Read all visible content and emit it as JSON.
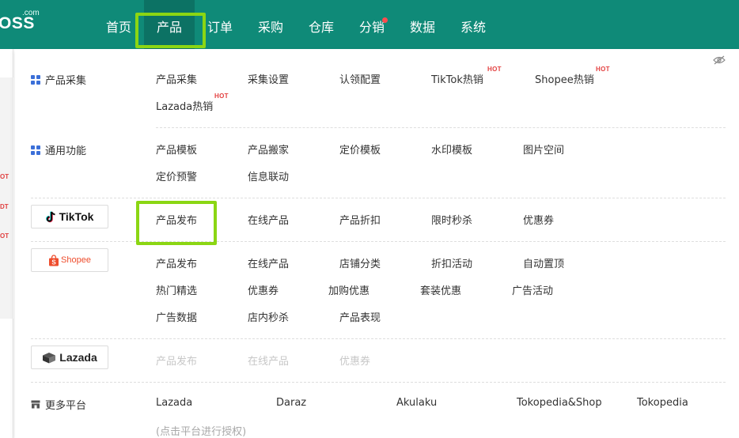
{
  "header": {
    "logo_suffix": ".com",
    "logo_text": "OSS",
    "nav": [
      {
        "label": "首页",
        "active": false,
        "dot": false
      },
      {
        "label": "产品",
        "active": true,
        "dot": false
      },
      {
        "label": "订单",
        "active": false,
        "dot": false
      },
      {
        "label": "采购",
        "active": false,
        "dot": false
      },
      {
        "label": "仓库",
        "active": false,
        "dot": false
      },
      {
        "label": "分销",
        "active": false,
        "dot": true
      },
      {
        "label": "数据",
        "active": false,
        "dot": false
      },
      {
        "label": "系统",
        "active": false,
        "dot": false
      }
    ],
    "colors": {
      "bar": "#0f8a78",
      "active": "#0c7264",
      "dot": "#ff4d4f"
    }
  },
  "background_strip": {
    "hot_1": "OT",
    "hot_2": "DT",
    "hot_3": "OT"
  },
  "dropdown": {
    "eye_icon": "eye-slash-icon",
    "sections": {
      "collect": {
        "label": "产品采集",
        "icon": "grid-icon",
        "items": [
          {
            "label": "产品采集"
          },
          {
            "label": "采集设置"
          },
          {
            "label": "认领配置"
          },
          {
            "label": "TikTok热销",
            "badge": "HOT"
          },
          {
            "label": "Shopee热销",
            "badge": "HOT"
          },
          {
            "label": "Lazada热销",
            "badge": "HOT"
          }
        ]
      },
      "common": {
        "label": "通用功能",
        "icon": "grid-icon",
        "items": [
          {
            "label": "产品模板"
          },
          {
            "label": "产品搬家"
          },
          {
            "label": "定价模板"
          },
          {
            "label": "水印模板"
          },
          {
            "label": "图片空间"
          },
          {
            "label": "定价预警"
          },
          {
            "label": "信息联动"
          }
        ]
      },
      "tiktok": {
        "logo_text": "TikTok",
        "items": [
          {
            "label": "产品发布"
          },
          {
            "label": "在线产品"
          },
          {
            "label": "产品折扣"
          },
          {
            "label": "限时秒杀"
          },
          {
            "label": "优惠券"
          }
        ]
      },
      "shopee": {
        "logo_text": "Shopee",
        "items": [
          {
            "label": "产品发布"
          },
          {
            "label": "在线产品"
          },
          {
            "label": "店铺分类"
          },
          {
            "label": "折扣活动"
          },
          {
            "label": "自动置顶"
          },
          {
            "label": "热门精选"
          },
          {
            "label": "优惠券"
          },
          {
            "label": "加购优惠"
          },
          {
            "label": "套装优惠"
          },
          {
            "label": "广告活动"
          },
          {
            "label": "广告数据"
          },
          {
            "label": "店内秒杀"
          },
          {
            "label": "产品表现"
          }
        ]
      },
      "lazada": {
        "logo_text": "Lazada",
        "items": [
          {
            "label": "产品发布",
            "disabled": true
          },
          {
            "label": "在线产品",
            "disabled": true
          },
          {
            "label": "优惠券",
            "disabled": true
          }
        ]
      },
      "more": {
        "label": "更多平台",
        "icon": "store-icon",
        "items": [
          {
            "label": "Lazada"
          },
          {
            "label": "Daraz"
          },
          {
            "label": "Akulaku"
          },
          {
            "label": "Tokopedia&Shop"
          },
          {
            "label": "Tokopedia"
          }
        ],
        "hint": "(点击平台进行授权)"
      }
    },
    "colors": {
      "highlight": "#8bd613",
      "hot": "#e34040",
      "disabled": "#c7c7c7"
    }
  }
}
